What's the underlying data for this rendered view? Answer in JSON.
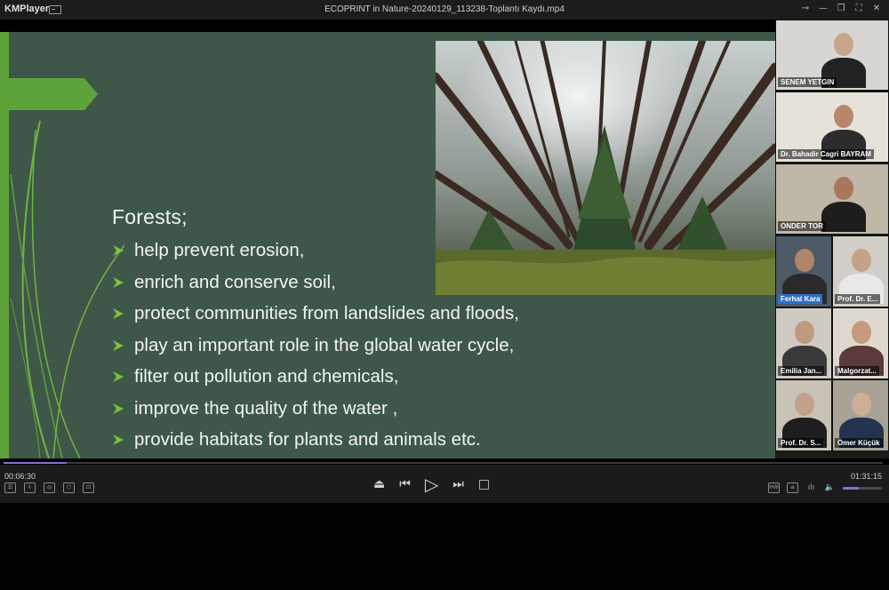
{
  "app": {
    "name": "KMPlayer",
    "file_title": "ECOPRINT in Nature-20240129_113238-Toplantı Kaydı.mp4"
  },
  "window_controls": [
    {
      "name": "pin-icon",
      "glyph": "⊸"
    },
    {
      "name": "minimize-icon",
      "glyph": "—"
    },
    {
      "name": "restore-icon",
      "glyph": "❐"
    },
    {
      "name": "fullscreen-icon",
      "glyph": "⛶"
    },
    {
      "name": "close-icon",
      "glyph": "✕"
    }
  ],
  "slide": {
    "heading": "Forests;",
    "bullets": [
      "help prevent erosion,",
      "enrich and conserve soil,",
      "protect communities from landslides and floods,",
      "play an important role in the global water cycle,",
      "filter out pollution and chemicals,",
      "improve the quality of the water ,",
      "provide habitats for plants and animals etc."
    ],
    "bullet_color": "#7cc242",
    "background": "#3f5748"
  },
  "participants": [
    {
      "name": "SENEM YETGIN",
      "layout": "full",
      "highlight": false
    },
    {
      "name": "Dr. Bahadir Cagri BAYRAM",
      "layout": "full",
      "highlight": false
    },
    {
      "name": "ONDER TOR",
      "layout": "full",
      "highlight": false
    },
    {
      "name": "Ferhat Kara",
      "layout": "half-l",
      "highlight": true
    },
    {
      "name": "Prof. Dr. E...",
      "layout": "half-r",
      "highlight": false
    },
    {
      "name": "Emilia Jan...",
      "layout": "half-l",
      "highlight": false
    },
    {
      "name": "Malgorzat...",
      "layout": "half-r",
      "highlight": false
    },
    {
      "name": "Prof. Dr. S...",
      "layout": "half-l",
      "highlight": false
    },
    {
      "name": "Ömer Küçük",
      "layout": "half-r",
      "highlight": false
    }
  ],
  "playback": {
    "elapsed": "00:06:30",
    "total": "01:31:15",
    "progress": 0.072,
    "volume": 0.4,
    "accent": "#8a6cd8"
  },
  "left_tools": [
    {
      "name": "playlist-icon",
      "glyph": "☰"
    },
    {
      "name": "download-icon",
      "glyph": "⇩"
    },
    {
      "name": "vr-icon",
      "glyph": "◎"
    },
    {
      "name": "3d-cube-icon",
      "glyph": "⬡"
    },
    {
      "name": "capture-icon",
      "glyph": "⊡"
    }
  ],
  "transport": [
    {
      "name": "eject-button",
      "glyph": "⏏"
    },
    {
      "name": "previous-button",
      "glyph": "⏮"
    },
    {
      "name": "play-button",
      "glyph": "▷"
    },
    {
      "name": "next-button",
      "glyph": "⏭"
    },
    {
      "name": "stop-button",
      "glyph": "□"
    }
  ],
  "right_tools": [
    {
      "name": "hw-decoder-icon",
      "glyph": "HW"
    },
    {
      "name": "subtitle-icon",
      "glyph": "≡"
    },
    {
      "name": "equalizer-icon",
      "glyph": "ılı"
    },
    {
      "name": "volume-icon",
      "glyph": "🔈"
    }
  ]
}
